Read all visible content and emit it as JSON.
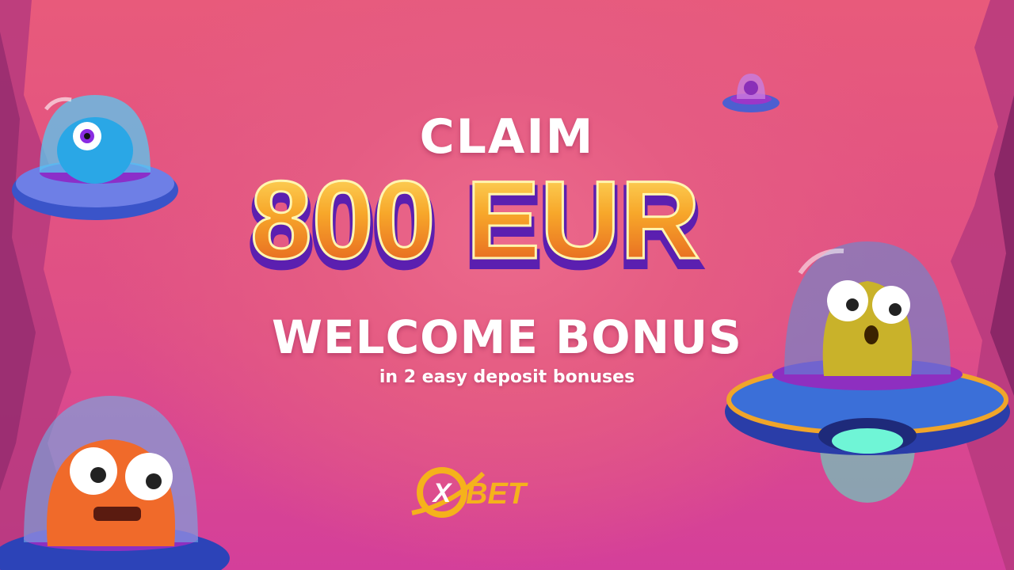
{
  "banner": {
    "claim_text": "CLAIM",
    "amount_text": "800 EUR",
    "bonus_title": "WELCOME BONUS",
    "subtitle": "in 2 easy deposit bonuses"
  },
  "brand": {
    "logo_letter": "X",
    "logo_word": "BET"
  },
  "colors": {
    "background": "#e55c83",
    "amount_fill": "#f7a72a",
    "amount_outline": "#7a2bd4",
    "logo_gold": "#f5b21b"
  },
  "illustrations": [
    "ufo-blue-alien-icon",
    "ufo-small-icon",
    "ufo-green-alien-icon",
    "ufo-orange-alien-icon"
  ]
}
